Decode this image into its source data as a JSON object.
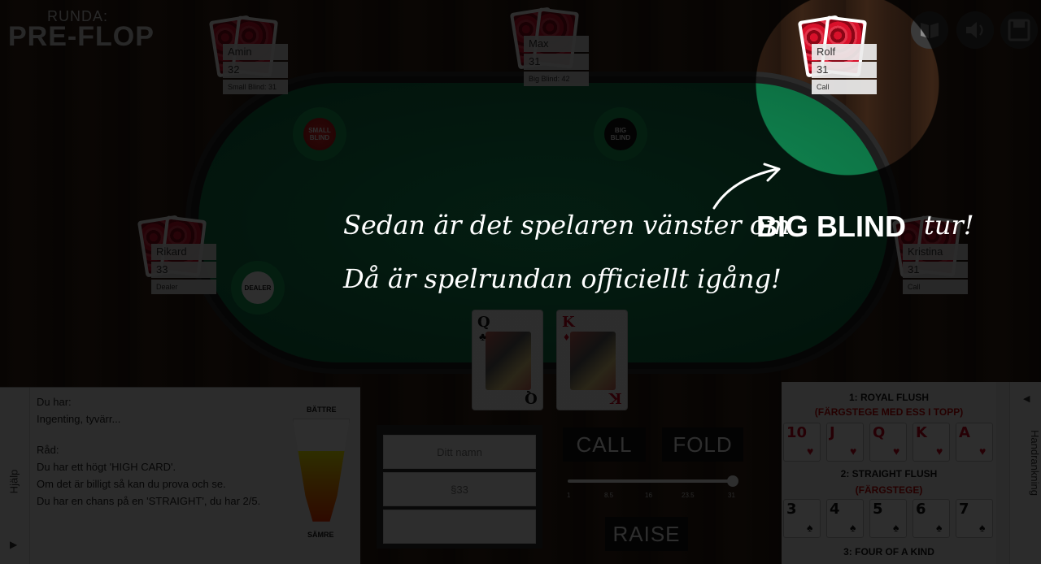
{
  "round": {
    "label": "RUNDA:",
    "value": "PRE-FLOP"
  },
  "players": [
    {
      "name": "Amin",
      "chips": "32",
      "action": "Small Blind: 31"
    },
    {
      "name": "Max",
      "chips": "31",
      "action": "Big Blind: 42"
    },
    {
      "name": "Rolf",
      "chips": "31",
      "action": "Call"
    },
    {
      "name": "Rikard",
      "chips": "33",
      "action": "Dealer"
    },
    {
      "name": "Kristina",
      "chips": "31",
      "action": "Call"
    }
  ],
  "chips": {
    "small_blind": "SMALL BLIND",
    "big_blind": "BIG BLIND",
    "dealer": "DEALER"
  },
  "hole_cards": [
    {
      "rank": "Q",
      "suit": "♣",
      "color": "#111111"
    },
    {
      "rank": "K",
      "suit": "♦",
      "color": "#d0021b"
    }
  ],
  "tutorial": {
    "line1_part1": "Sedan är det spelaren vänster om",
    "line1_strong": "BIG BLIND",
    "line1_part2": "tur!",
    "line2": "Då är spelrundan officiellt igång!"
  },
  "help": {
    "tab_label": "Hjälp",
    "lines": [
      "Du har:",
      "Ingenting, tyvärr...",
      "Råd:",
      "Du har ett högt 'HIGH CARD'.",
      "Om det är billigt så kan du prova och se.",
      "Du har en chans på en 'STRAIGHT', du har 2/5."
    ],
    "meter_top": "BÄTTRE",
    "meter_bottom": "SÄMRE",
    "meter_level": 0.7
  },
  "inputs": {
    "name_placeholder": "Ditt namn",
    "money": "§33"
  },
  "actions": {
    "call": "CALL",
    "fold": "FOLD",
    "raise": "RAISE"
  },
  "slider": {
    "ticks": [
      "1",
      "8.5",
      "16",
      "23.5",
      "31"
    ],
    "value": 31
  },
  "hand_ranking": {
    "tab_label": "Handrankning",
    "hands": [
      {
        "title": "1: ROYAL FLUSH",
        "subtitle": "(FÄRGSTEGE MED ESS I TOPP)",
        "cards": [
          {
            "r": "10",
            "s": "♥"
          },
          {
            "r": "J",
            "s": "♥"
          },
          {
            "r": "Q",
            "s": "♥"
          },
          {
            "r": "K",
            "s": "♥"
          },
          {
            "r": "A",
            "s": "♥"
          }
        ],
        "red": true
      },
      {
        "title": "2: STRAIGHT FLUSH",
        "subtitle": "(FÄRGSTEGE)",
        "cards": [
          {
            "r": "3",
            "s": "♠"
          },
          {
            "r": "4",
            "s": "♠"
          },
          {
            "r": "5",
            "s": "♠"
          },
          {
            "r": "6",
            "s": "♠"
          },
          {
            "r": "7",
            "s": "♠"
          }
        ],
        "red": false
      },
      {
        "title": "3: FOUR OF A KIND",
        "subtitle": "",
        "cards": [],
        "red": false
      }
    ]
  },
  "icons": [
    "book-icon",
    "speaker-icon",
    "save-icon"
  ]
}
